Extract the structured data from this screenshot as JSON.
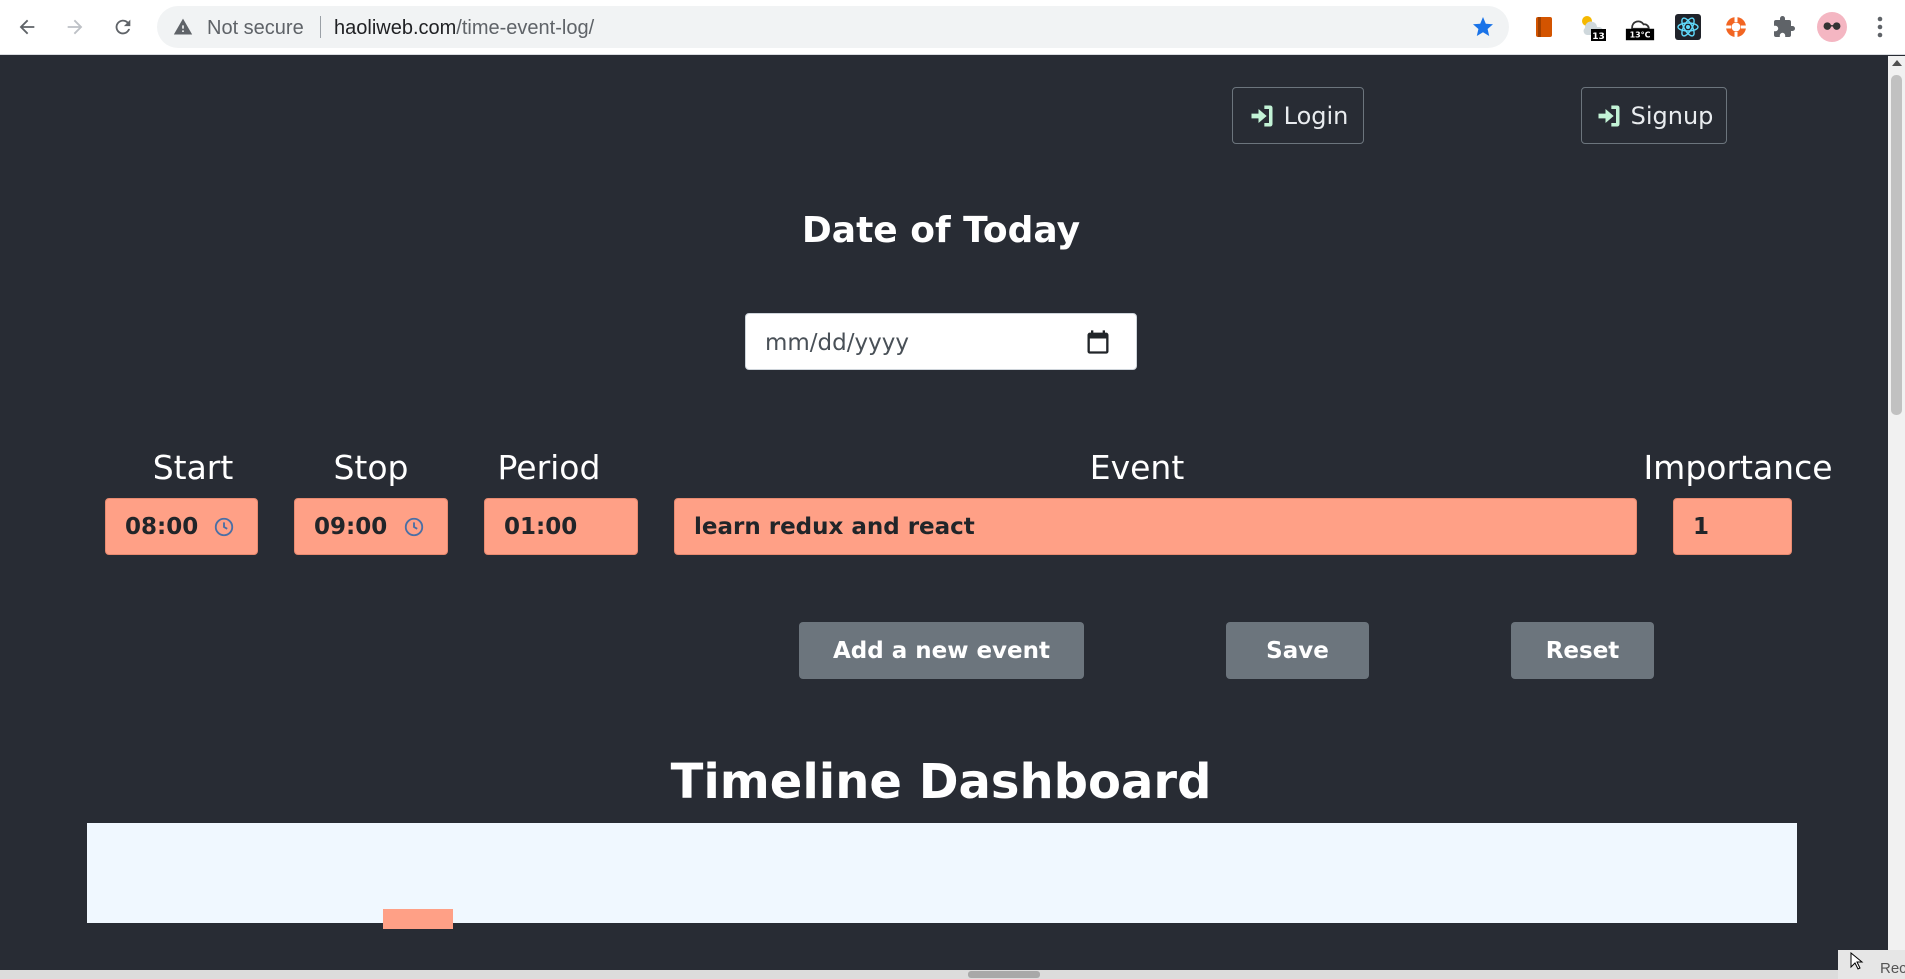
{
  "browser": {
    "not_secure_label": "Not secure",
    "url_domain": "haoliweb.com",
    "url_path": "/time-event-log/",
    "nav_icons": [
      "back-arrow-icon",
      "forward-arrow-icon",
      "reload-icon"
    ],
    "weather_temp_1": "13",
    "weather_temp_2": "13°C",
    "accent_color": "#1a73e8"
  },
  "header": {
    "login_label": "Login",
    "signup_label": "Signup"
  },
  "date_section": {
    "title": "Date of Today",
    "date_placeholder": "mm/dd/yyyy"
  },
  "event_form": {
    "labels": {
      "start": "Start",
      "stop": "Stop",
      "period": "Period",
      "event": "Event",
      "importance": "Importance"
    },
    "values": {
      "start": "08:00",
      "stop": "09:00",
      "period": "01:00",
      "event": "learn redux and react",
      "importance": "1"
    },
    "field_color": "#ffa086"
  },
  "actions": {
    "add_label": "Add a new event",
    "save_label": "Save",
    "reset_label": "Reset"
  },
  "dashboard": {
    "title": "Timeline Dashboard",
    "panel_color": "#f0f8ff"
  },
  "overlay": {
    "corner_text": "Recor"
  },
  "theme": {
    "page_background": "#282c34",
    "button_gray": "#6c757d"
  }
}
